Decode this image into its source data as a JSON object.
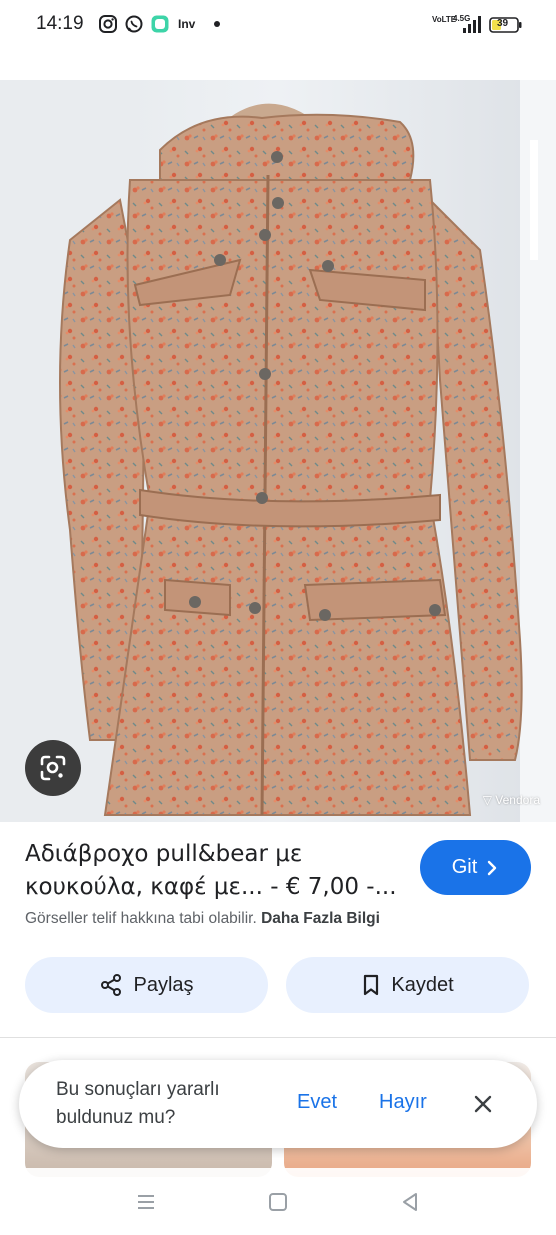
{
  "status_bar": {
    "time": "14:19",
    "app_icons": [
      "instagram-icon",
      "whatsapp-icon",
      "chat-icon",
      "inv-icon"
    ],
    "inv_label": "Inv",
    "network_label": "VoLTE",
    "signal_label": "4.5G",
    "battery": "39"
  },
  "image": {
    "watermark": "Vendora",
    "lens_icon": "lens-search-icon"
  },
  "result": {
    "title_line1": "Αδιάβροχο pull&bear με",
    "title_line2": "κουκούλα, καφέ με... - € 7,00 -...",
    "go_label": "Git",
    "copyright_text": "Görseller telif hakkına tabi olabilir.",
    "more_info_label": "Daha Fazla Bilgi"
  },
  "actions": {
    "share_label": "Paylaş",
    "save_label": "Kaydet"
  },
  "feedback": {
    "question": "Bu sonuçları yararlı buldunuz mu?",
    "yes_label": "Evet",
    "no_label": "Hayır"
  },
  "colors": {
    "accent": "#1a73e8",
    "button_bg": "#e8f0fe",
    "coat": "#c79a7d"
  }
}
